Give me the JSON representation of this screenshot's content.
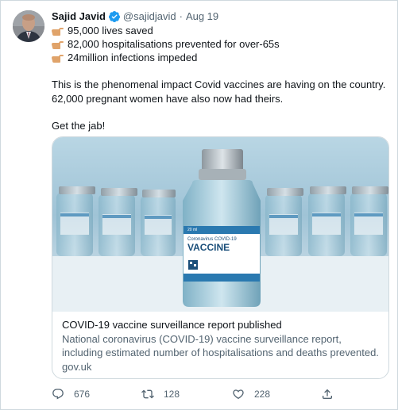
{
  "tweet": {
    "author_name": "Sajid Javid",
    "handle": "@sajidjavid",
    "separator": "·",
    "time": "Aug 19",
    "lines": [
      "95,000 lives saved",
      "82,000 hospitalisations prevented for over-65s",
      "24million infections impeded"
    ],
    "paragraph1_line1": "This is the phenomenal impact Covid vaccines are having on the country.",
    "paragraph1_line2": "62,000 pregnant women have also now had theirs.",
    "paragraph2": "Get the jab!",
    "card": {
      "title": "COVID-19 vaccine surveillance report published",
      "description": "National coronavirus (COVID-19) vaccine surveillance report, including estimated number of hospitalisations and deaths prevented.",
      "domain": "gov.uk",
      "image": {
        "label_line1": "Coronavirus COVID-19",
        "label_line2": "VACCINE",
        "volume": "20 ml"
      }
    },
    "actions": {
      "replies": "676",
      "retweets": "128",
      "likes": "228"
    }
  },
  "colors": {
    "accent_blue": "#1d9bf0",
    "text_primary": "#0f1419",
    "text_secondary": "#536471",
    "border": "#cfd9de"
  }
}
